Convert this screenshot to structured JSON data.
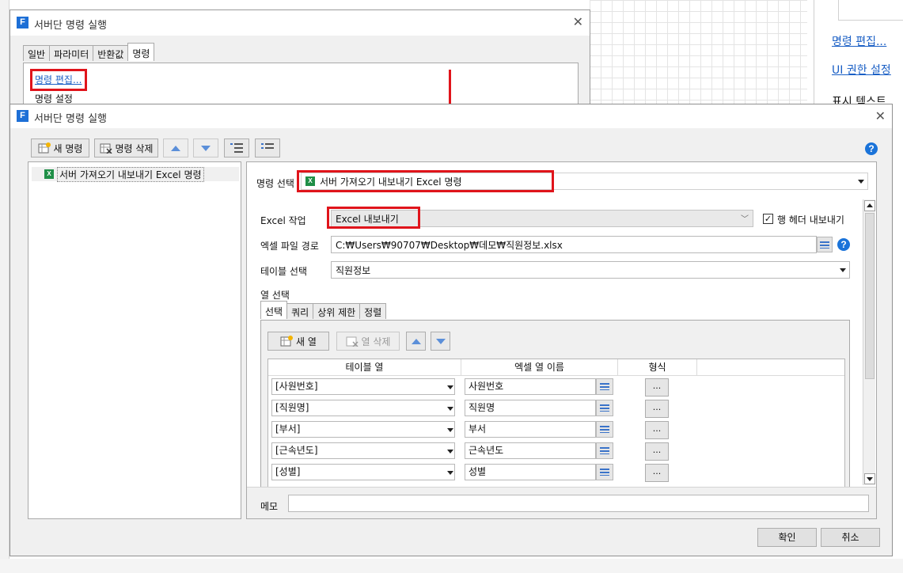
{
  "background": {
    "right_panel": {
      "link_edit": "명령 편집...",
      "link_ui_permission": "UI 권한 설정",
      "display_text": "표시 텍스트"
    }
  },
  "back_dialog": {
    "title": "서버단 명령 실행",
    "tabs": [
      "일반",
      "파라미터",
      "반환값",
      "명령"
    ],
    "active_tab": "명령",
    "edit_link": "명령 편집...",
    "settings_label": "명령 설정"
  },
  "main_dialog": {
    "title": "서버단 명령 실행",
    "toolbar": {
      "new_command": "새 명령",
      "delete_command": "명령 삭제"
    },
    "tree": {
      "item": "서버 가져오기 내보내기 Excel 명령"
    },
    "command_select": {
      "label": "명령 선택",
      "value": "서버 가져오기 내보내기 Excel 명령"
    },
    "excel_action": {
      "label": "Excel 작업",
      "value": "Excel 내보내기",
      "export_row_header_label": "행 헤더 내보내기",
      "export_row_header_checked": true
    },
    "file_path": {
      "label": "엑셀 파일 경로",
      "value": "C:₩Users₩90707₩Desktop₩데모₩직원정보.xlsx"
    },
    "table_select": {
      "label": "테이블 선택",
      "value": "직원정보"
    },
    "column_select": {
      "label": "열 선택",
      "tabs": [
        "선택",
        "쿼리",
        "상위 제한",
        "정렬"
      ],
      "active_tab": "선택",
      "new_column": "새 열",
      "delete_column": "열 삭제",
      "headers": [
        "테이블 열",
        "엑셀 열 이름",
        "형식"
      ],
      "rows": [
        {
          "table_col": "[사원번호]",
          "excel_name": "사원번호",
          "format": "..."
        },
        {
          "table_col": "[직원명]",
          "excel_name": "직원명",
          "format": "..."
        },
        {
          "table_col": "[부서]",
          "excel_name": "부서",
          "format": "..."
        },
        {
          "table_col": "[근속년도]",
          "excel_name": "근속년도",
          "format": "..."
        },
        {
          "table_col": "[성별]",
          "excel_name": "성별",
          "format": "..."
        }
      ]
    },
    "memo": {
      "label": "메모",
      "value": ""
    },
    "ok": "확인",
    "cancel": "취소"
  },
  "colors": {
    "highlight_red": "#e0141b",
    "link_blue": "#1a5fc5",
    "logo_blue": "#1d6fd6",
    "excel_green": "#1f8f47"
  }
}
